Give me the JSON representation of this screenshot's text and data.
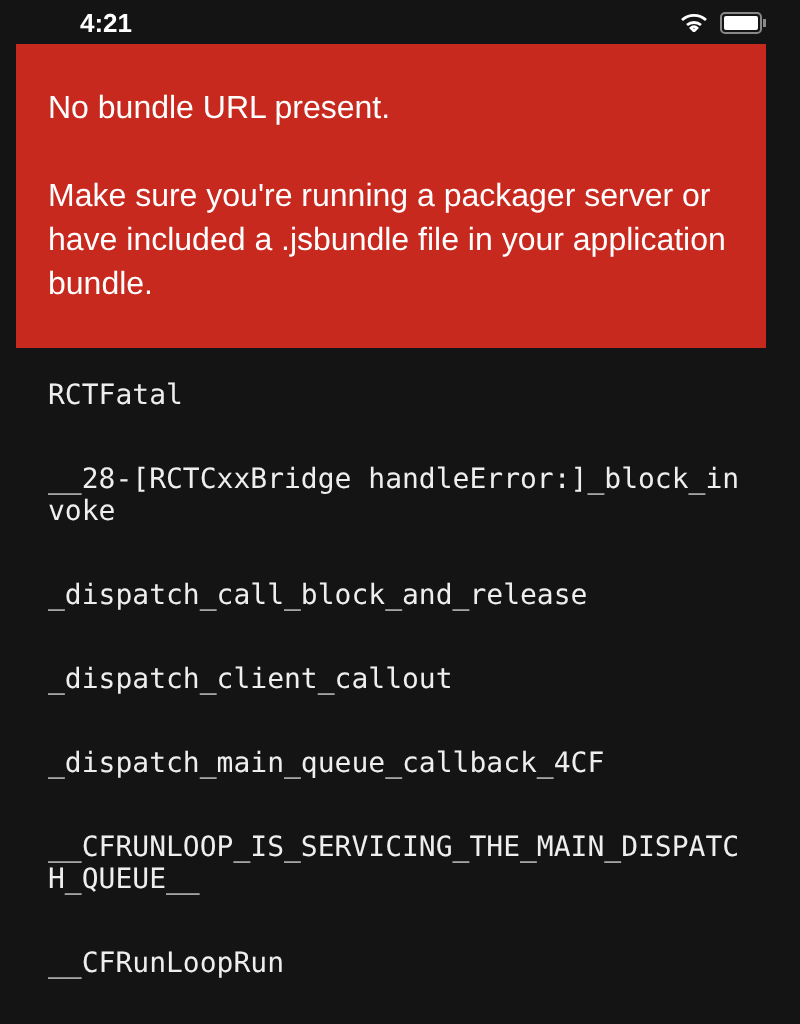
{
  "status_bar": {
    "time": "4:21"
  },
  "error_banner": {
    "title": "No bundle URL present.",
    "message": "Make sure you're running a packager server or have included a .jsbundle file in your application bundle."
  },
  "stack_frames": [
    "RCTFatal",
    "__28-[RCTCxxBridge handleError:]_block_invoke",
    "_dispatch_call_block_and_release",
    "_dispatch_client_callout",
    "_dispatch_main_queue_callback_4CF",
    "__CFRUNLOOP_IS_SERVICING_THE_MAIN_DISPATCH_QUEUE__",
    "__CFRunLoopRun"
  ]
}
